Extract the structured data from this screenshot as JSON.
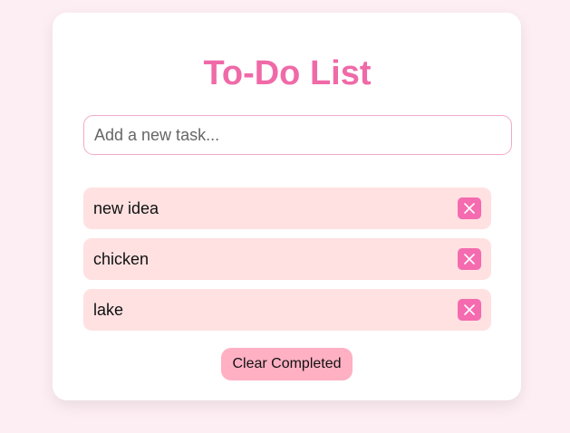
{
  "app": {
    "title": "To-Do List"
  },
  "new_task": {
    "placeholder": "Add a new task...",
    "value": ""
  },
  "tasks": [
    {
      "text": "new idea",
      "delete_icon": "close-icon"
    },
    {
      "text": "chicken",
      "delete_icon": "close-icon"
    },
    {
      "text": "lake",
      "delete_icon": "close-icon"
    }
  ],
  "actions": {
    "clear_completed_label": "Clear Completed"
  },
  "colors": {
    "background": "#fdeef4",
    "accent": "#f06aa8",
    "task_background": "#ffe1e1",
    "delete_button": "#f56bb0",
    "clear_button": "#ffb0c3"
  }
}
